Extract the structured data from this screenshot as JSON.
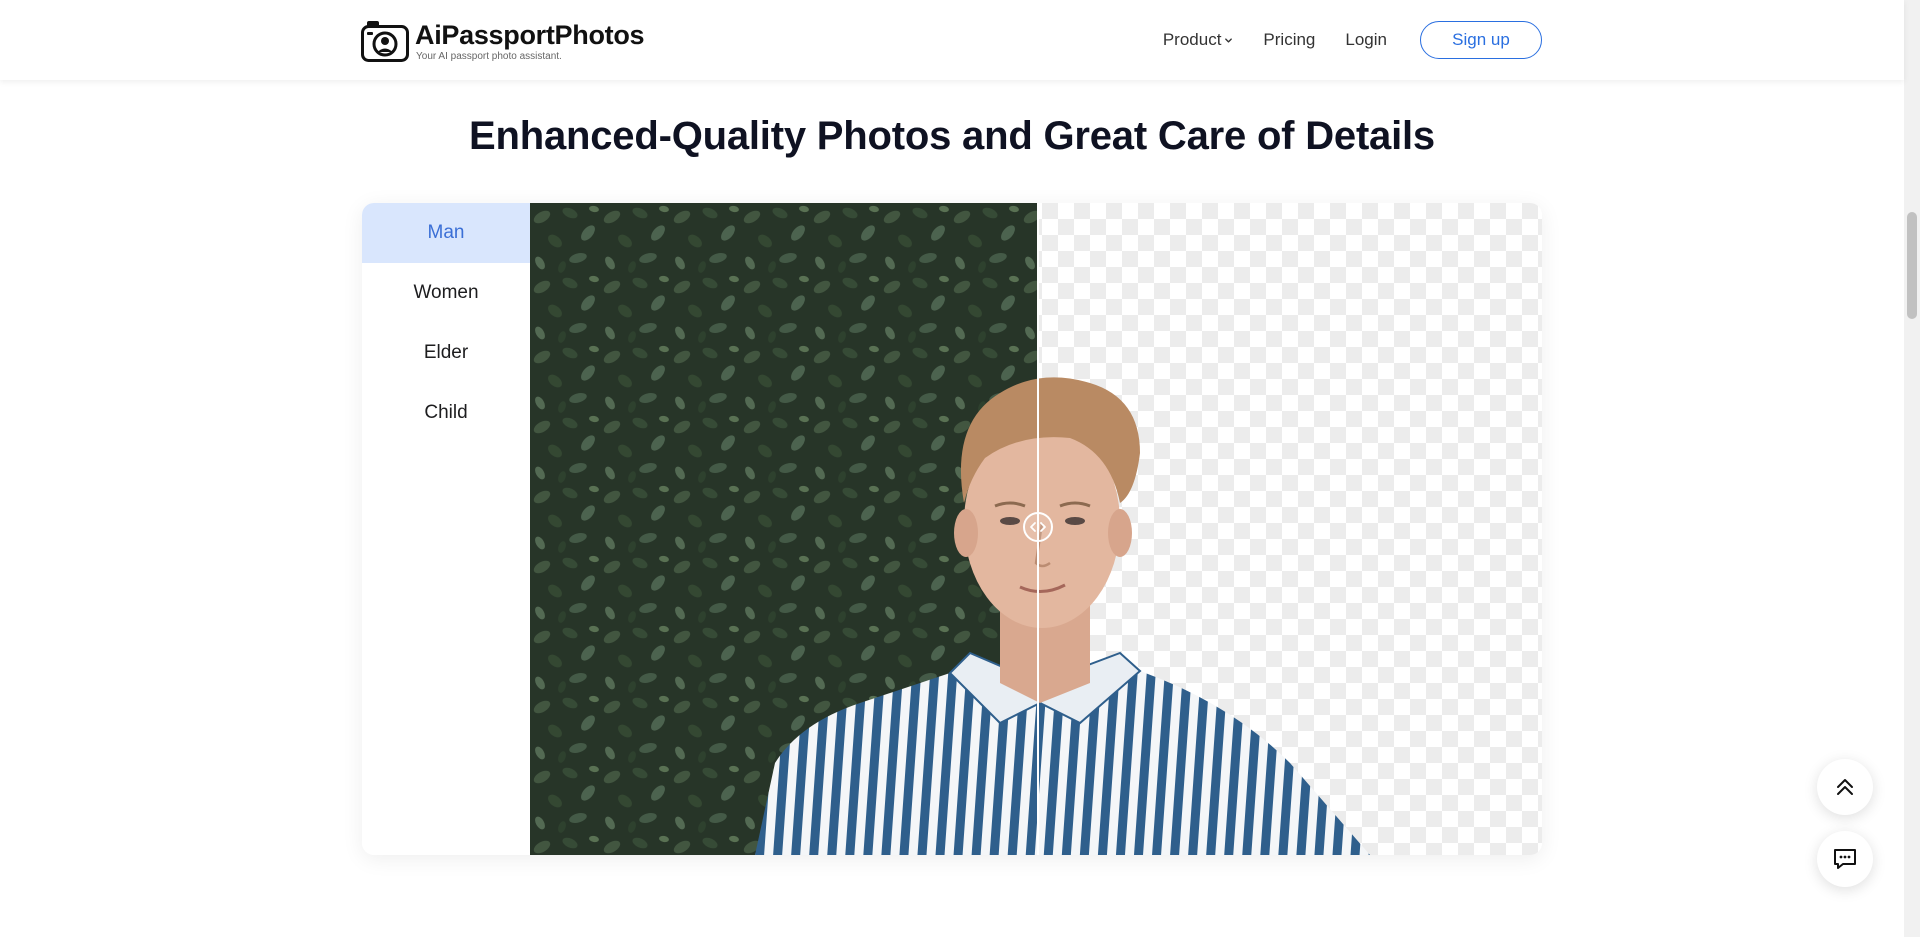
{
  "header": {
    "brand": {
      "name": "AiPassportPhotos",
      "tagline": "Your AI passport photo assistant."
    },
    "nav": {
      "product_label": "Product",
      "pricing_label": "Pricing",
      "login_label": "Login",
      "signup_label": "Sign up"
    }
  },
  "section": {
    "title": "Enhanced-Quality Photos and Great Care of Details",
    "tabs": [
      {
        "label": "Man",
        "active": true
      },
      {
        "label": "Women",
        "active": false
      },
      {
        "label": "Elder",
        "active": false
      },
      {
        "label": "Child",
        "active": false
      }
    ],
    "comparison": {
      "before_description": "original photo with foliage background",
      "after_description": "background removed, transparent checkerboard",
      "slider_position_percent": 50
    }
  },
  "floating_buttons": {
    "back_to_top_icon": "double-chevron-up-icon",
    "chat_icon": "message-icon"
  },
  "colors": {
    "accent": "#2a6fe0",
    "active_tab_bg": "#d9e6fd",
    "active_tab_text": "#3b6fd6",
    "title_text": "#0f1222"
  }
}
